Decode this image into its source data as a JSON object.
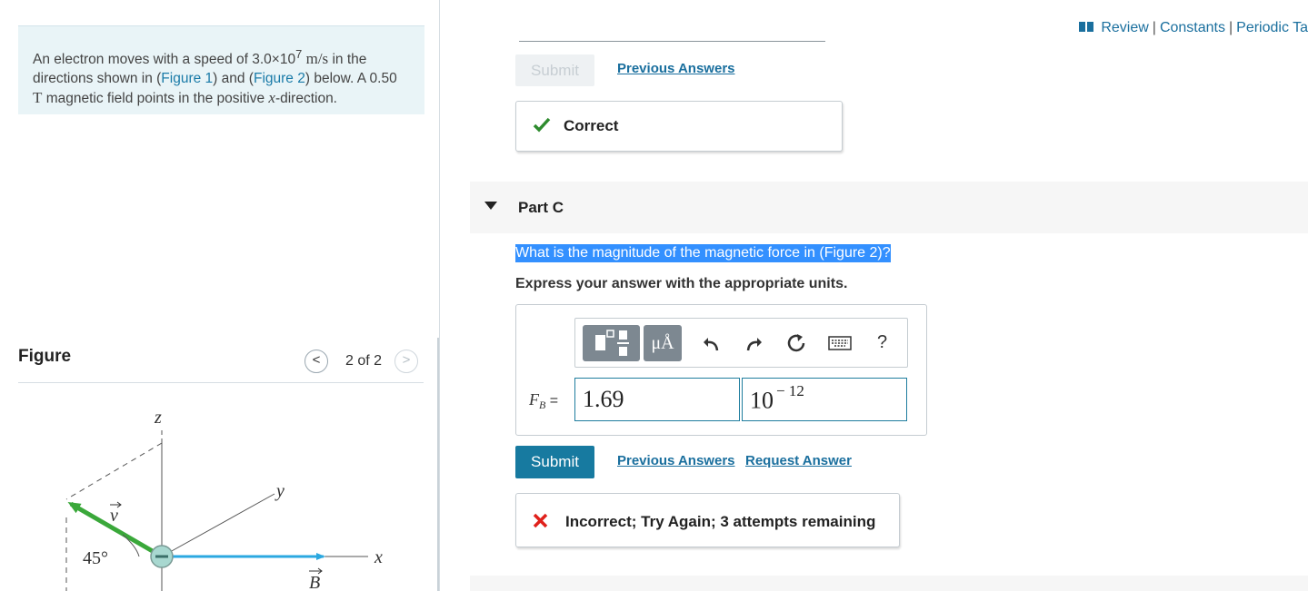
{
  "problem": {
    "text_1": "An electron moves with a speed of ",
    "speed": "3.0×10",
    "speed_exp": "7",
    "speed_unit": "m/s",
    "text_2": " in the directions shown in (",
    "figure1_link": "Figure 1",
    "text_3": ") and (",
    "figure2_link": "Figure 2",
    "text_4": ") below. A 0.50 ",
    "field_unit": "T",
    "text_5": " magnetic field points in the positive ",
    "axis_var": "x",
    "text_6": "-direction."
  },
  "figure": {
    "title": "Figure",
    "prev_label": "<",
    "next_label": ">",
    "counter": "2 of 2",
    "labels": {
      "z": "z",
      "y": "y",
      "x": "x",
      "v": "v",
      "b": "B",
      "angle": "45°"
    }
  },
  "top_links": {
    "review": "Review",
    "constants": "Constants",
    "periodic": "Periodic Ta"
  },
  "part_b": {
    "submit_label": "Submit",
    "previous_answers_label": "Previous Answers",
    "feedback": "Correct"
  },
  "part_c": {
    "title": "Part C",
    "question": "What is the magnitude of the magnetic force in (Figure 2)?",
    "instruction": "Express your answer with the appropriate units.",
    "toolbar": {
      "units_glyph": "μÅ",
      "help": "?"
    },
    "input_label_main": "F",
    "input_label_sub": "B",
    "input_label_eq": " =",
    "value": "1.69",
    "unit_base": "10",
    "unit_exp": "− 12",
    "submit_label": "Submit",
    "previous_answers_label": "Previous Answers",
    "request_answer_label": "Request Answer",
    "feedback": "Incorrect; Try Again; 3 attempts remaining"
  },
  "colors": {
    "accent_blue": "#177aa0",
    "link_blue": "#1a6f9e",
    "correct_green": "#2e8b2e",
    "incorrect_red": "#e0201b",
    "velocity_green": "#3aa83a",
    "field_blue": "#2ba8e0",
    "selection_blue": "#3390ff"
  }
}
